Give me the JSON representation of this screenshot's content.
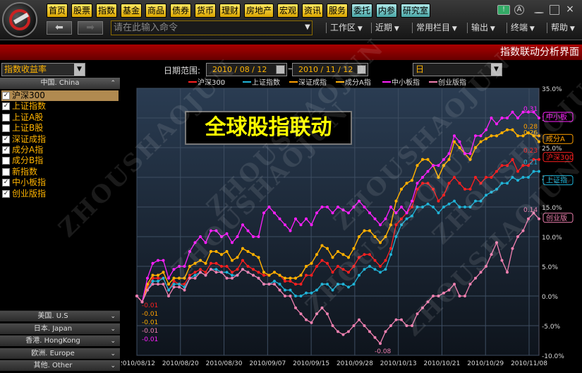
{
  "toolbar": {
    "nav": [
      {
        "label": "首页",
        "teal": false
      },
      {
        "label": "股票",
        "teal": false
      },
      {
        "label": "指数",
        "teal": false
      },
      {
        "label": "基金",
        "teal": false
      },
      {
        "label": "商品",
        "teal": false
      },
      {
        "label": "债券",
        "teal": false
      },
      {
        "label": "货币",
        "teal": false
      },
      {
        "label": "理财",
        "teal": false
      },
      {
        "label": "房地产",
        "teal": false
      },
      {
        "label": "宏观",
        "teal": false
      },
      {
        "label": "资讯",
        "teal": false
      },
      {
        "label": "服务",
        "teal": false
      },
      {
        "label": "委托",
        "teal": true
      },
      {
        "label": "内参",
        "teal": true
      },
      {
        "label": "研究室",
        "teal": true
      }
    ],
    "command_placeholder": "请在此输入命令",
    "menus": [
      "工作区",
      "近期",
      "常用栏目",
      "输出",
      "终端",
      "帮助"
    ],
    "back_icon": "back-arrow-icon",
    "forward_icon": "forward-arrow-icon"
  },
  "banner": {
    "title": "指数联动分析界面"
  },
  "controls": {
    "indicator_select": "指数收益率",
    "date_range_label": "日期范围:",
    "start_date": "2010 / 08 / 12",
    "end_date": "2010 / 11 / 12",
    "period_select": "日"
  },
  "sidebar": {
    "group": "中国. China",
    "items": [
      {
        "label": "沪深300",
        "checked": true,
        "selected": true
      },
      {
        "label": "上证指数",
        "checked": true,
        "selected": false
      },
      {
        "label": "上证A股",
        "checked": false,
        "selected": false
      },
      {
        "label": "上证B股",
        "checked": false,
        "selected": false
      },
      {
        "label": "深证成指",
        "checked": true,
        "selected": false
      },
      {
        "label": "成分A指",
        "checked": true,
        "selected": false
      },
      {
        "label": "成分B指",
        "checked": false,
        "selected": false
      },
      {
        "label": "新指数",
        "checked": false,
        "selected": false
      },
      {
        "label": "中小板指",
        "checked": true,
        "selected": false
      },
      {
        "label": "创业版指",
        "checked": true,
        "selected": false
      }
    ],
    "regions": [
      "美国. U.S",
      "日本. Japan",
      "香港. HongKong",
      "欧洲. Europe",
      "其他. Other"
    ]
  },
  "overlay_title": "全球股指联动",
  "watermark": "ZHOUSHAOJUN",
  "chart_data": {
    "type": "line",
    "title": "",
    "x_ticks": [
      "2010/08/12",
      "2010/08/20",
      "2010/08/30",
      "2010/09/07",
      "2010/09/15",
      "2010/09/28",
      "2010/10/13",
      "2010/10/21",
      "2010/10/29",
      "2010/11/08"
    ],
    "y_ticks": [
      "35.0%",
      "30.0%",
      "25.0%",
      "20.0%",
      "15.0%",
      "10.0%",
      "5.0%",
      "0.0%",
      "-5.0%",
      "-10.0%"
    ],
    "ylim": [
      -0.1,
      0.35
    ],
    "grid": true,
    "legend_position": "top",
    "series": [
      {
        "name": "沪深300",
        "color": "#ff2020",
        "end_label": "沪深300",
        "end_value_label": "0.23",
        "values": [
          0,
          -0.01,
          0.015,
          0.03,
          0.03,
          0.03,
          0.01,
          0.025,
          0.02,
          0.02,
          0.035,
          0.04,
          0.045,
          0.04,
          0.055,
          0.055,
          0.05,
          0.05,
          0.04,
          0.045,
          0.06,
          0.05,
          0.045,
          0.04,
          0.035,
          0.035,
          0.04,
          0.035,
          0.025,
          0.025,
          0.02,
          0.02,
          0.035,
          0.035,
          0.05,
          0.06,
          0.055,
          0.04,
          0.05,
          0.045,
          0.04,
          0.05,
          0.065,
          0.07,
          0.07,
          0.06,
          0.05,
          0.06,
          0.08,
          0.12,
          0.13,
          0.14,
          0.15,
          0.18,
          0.19,
          0.19,
          0.18,
          0.16,
          0.17,
          0.19,
          0.2,
          0.19,
          0.18,
          0.18,
          0.2,
          0.19,
          0.2,
          0.2,
          0.21,
          0.22,
          0.22,
          0.23,
          0.21,
          0.22,
          0.22,
          0.23,
          0.23
        ]
      },
      {
        "name": "上证指数",
        "color": "#20b4d8",
        "end_label": "上证指",
        "end_value_label": "0.21",
        "values": [
          0,
          -0.01,
          0.01,
          0.025,
          0.025,
          0.03,
          0.01,
          0.02,
          0.02,
          0.015,
          0.03,
          0.035,
          0.04,
          0.035,
          0.045,
          0.045,
          0.04,
          0.04,
          0.035,
          0.035,
          0.045,
          0.04,
          0.035,
          0.03,
          0.02,
          0.02,
          0.025,
          0.02,
          0.01,
          0.01,
          0.0,
          0.0,
          0.005,
          0.005,
          0.01,
          0.02,
          0.02,
          0.01,
          0.02,
          0.02,
          0.015,
          0.02,
          0.035,
          0.045,
          0.05,
          0.045,
          0.04,
          0.045,
          0.07,
          0.1,
          0.12,
          0.13,
          0.135,
          0.15,
          0.15,
          0.155,
          0.15,
          0.14,
          0.15,
          0.155,
          0.16,
          0.15,
          0.15,
          0.15,
          0.16,
          0.16,
          0.17,
          0.175,
          0.18,
          0.19,
          0.19,
          0.2,
          0.195,
          0.2,
          0.2,
          0.21,
          0.21
        ]
      },
      {
        "name": "深证成指",
        "color": "#ffa000",
        "end_label": "成分A",
        "end_value_label": "0.28",
        "values": [
          0,
          -0.01,
          0.02,
          0.035,
          0.035,
          0.04,
          0.02,
          0.03,
          0.03,
          0.03,
          0.05,
          0.055,
          0.06,
          0.055,
          0.075,
          0.075,
          0.07,
          0.075,
          0.06,
          0.065,
          0.08,
          0.075,
          0.07,
          0.065,
          0.04,
          0.035,
          0.04,
          0.035,
          0.03,
          0.03,
          0.03,
          0.035,
          0.05,
          0.055,
          0.07,
          0.085,
          0.08,
          0.065,
          0.075,
          0.07,
          0.065,
          0.08,
          0.1,
          0.11,
          0.11,
          0.1,
          0.09,
          0.1,
          0.12,
          0.16,
          0.18,
          0.19,
          0.195,
          0.22,
          0.23,
          0.23,
          0.22,
          0.2,
          0.22,
          0.23,
          0.26,
          0.25,
          0.24,
          0.23,
          0.25,
          0.26,
          0.265,
          0.27,
          0.27,
          0.275,
          0.28,
          0.28,
          0.27,
          0.27,
          0.275,
          0.27,
          0.27
        ]
      },
      {
        "name": "成分A指",
        "color": "#ffb000",
        "end_label": "",
        "end_value_label": "0.26",
        "values": [
          0,
          -0.01,
          0.02,
          0.035,
          0.035,
          0.04,
          0.02,
          0.03,
          0.03,
          0.03,
          0.05,
          0.055,
          0.06,
          0.055,
          0.075,
          0.075,
          0.07,
          0.075,
          0.06,
          0.065,
          0.08,
          0.075,
          0.07,
          0.065,
          0.04,
          0.035,
          0.04,
          0.035,
          0.03,
          0.03,
          0.03,
          0.035,
          0.05,
          0.055,
          0.07,
          0.085,
          0.08,
          0.065,
          0.075,
          0.07,
          0.065,
          0.08,
          0.1,
          0.11,
          0.11,
          0.1,
          0.09,
          0.1,
          0.12,
          0.16,
          0.18,
          0.19,
          0.195,
          0.22,
          0.23,
          0.23,
          0.22,
          0.2,
          0.22,
          0.23,
          0.26,
          0.25,
          0.24,
          0.23,
          0.25,
          0.26,
          0.265,
          0.27,
          0.27,
          0.275,
          0.28,
          0.28,
          0.27,
          0.27,
          0.275,
          0.27,
          0.26
        ]
      },
      {
        "name": "中小板指",
        "color": "#ff20ff",
        "end_label": "中小板",
        "end_value_label": "0.31",
        "values": [
          0,
          -0.01,
          0.03,
          0.055,
          0.06,
          0.06,
          0.03,
          0.045,
          0.05,
          0.05,
          0.075,
          0.09,
          0.1,
          0.09,
          0.11,
          0.11,
          0.1,
          0.105,
          0.09,
          0.1,
          0.12,
          0.11,
          0.1,
          0.1,
          0.14,
          0.15,
          0.14,
          0.13,
          0.12,
          0.11,
          0.13,
          0.12,
          0.13,
          0.12,
          0.14,
          0.15,
          0.15,
          0.14,
          0.15,
          0.145,
          0.14,
          0.15,
          0.16,
          0.15,
          0.14,
          0.13,
          0.12,
          0.13,
          0.15,
          0.14,
          0.15,
          0.14,
          0.16,
          0.19,
          0.2,
          0.21,
          0.22,
          0.22,
          0.23,
          0.24,
          0.27,
          0.26,
          0.24,
          0.24,
          0.27,
          0.27,
          0.28,
          0.3,
          0.29,
          0.3,
          0.3,
          0.31,
          0.3,
          0.31,
          0.31,
          0.31,
          0.3
        ]
      },
      {
        "name": "创业版指",
        "color": "#f080b0",
        "end_label": "创业版",
        "end_value_label": "0.14",
        "values": [
          0,
          -0.01,
          0.01,
          0.02,
          0.02,
          0.02,
          0.0,
          0.015,
          0.015,
          0.01,
          0.03,
          0.03,
          0.04,
          0.035,
          0.045,
          0.04,
          0.04,
          0.03,
          0.03,
          0.035,
          0.045,
          0.04,
          0.035,
          0.03,
          0.02,
          0.02,
          0.02,
          0.01,
          0.0,
          0.0,
          -0.02,
          -0.03,
          -0.04,
          -0.045,
          -0.03,
          -0.02,
          -0.03,
          -0.05,
          -0.06,
          -0.065,
          -0.06,
          -0.05,
          -0.04,
          -0.05,
          -0.06,
          -0.07,
          -0.08,
          -0.06,
          -0.05,
          -0.04,
          -0.04,
          -0.05,
          -0.05,
          -0.03,
          -0.02,
          -0.01,
          0.0,
          0.0,
          0.005,
          0.01,
          0.02,
          0.0,
          0.0,
          0.02,
          0.03,
          0.04,
          0.05,
          0.07,
          0.09,
          0.06,
          0.04,
          0.08,
          0.1,
          0.11,
          0.13,
          0.14,
          0.13
        ]
      }
    ],
    "start_labels": [
      "-0.01",
      "-0.01",
      "-0.01",
      "-0.01",
      "-0.01"
    ],
    "min_label": "-0.08"
  }
}
